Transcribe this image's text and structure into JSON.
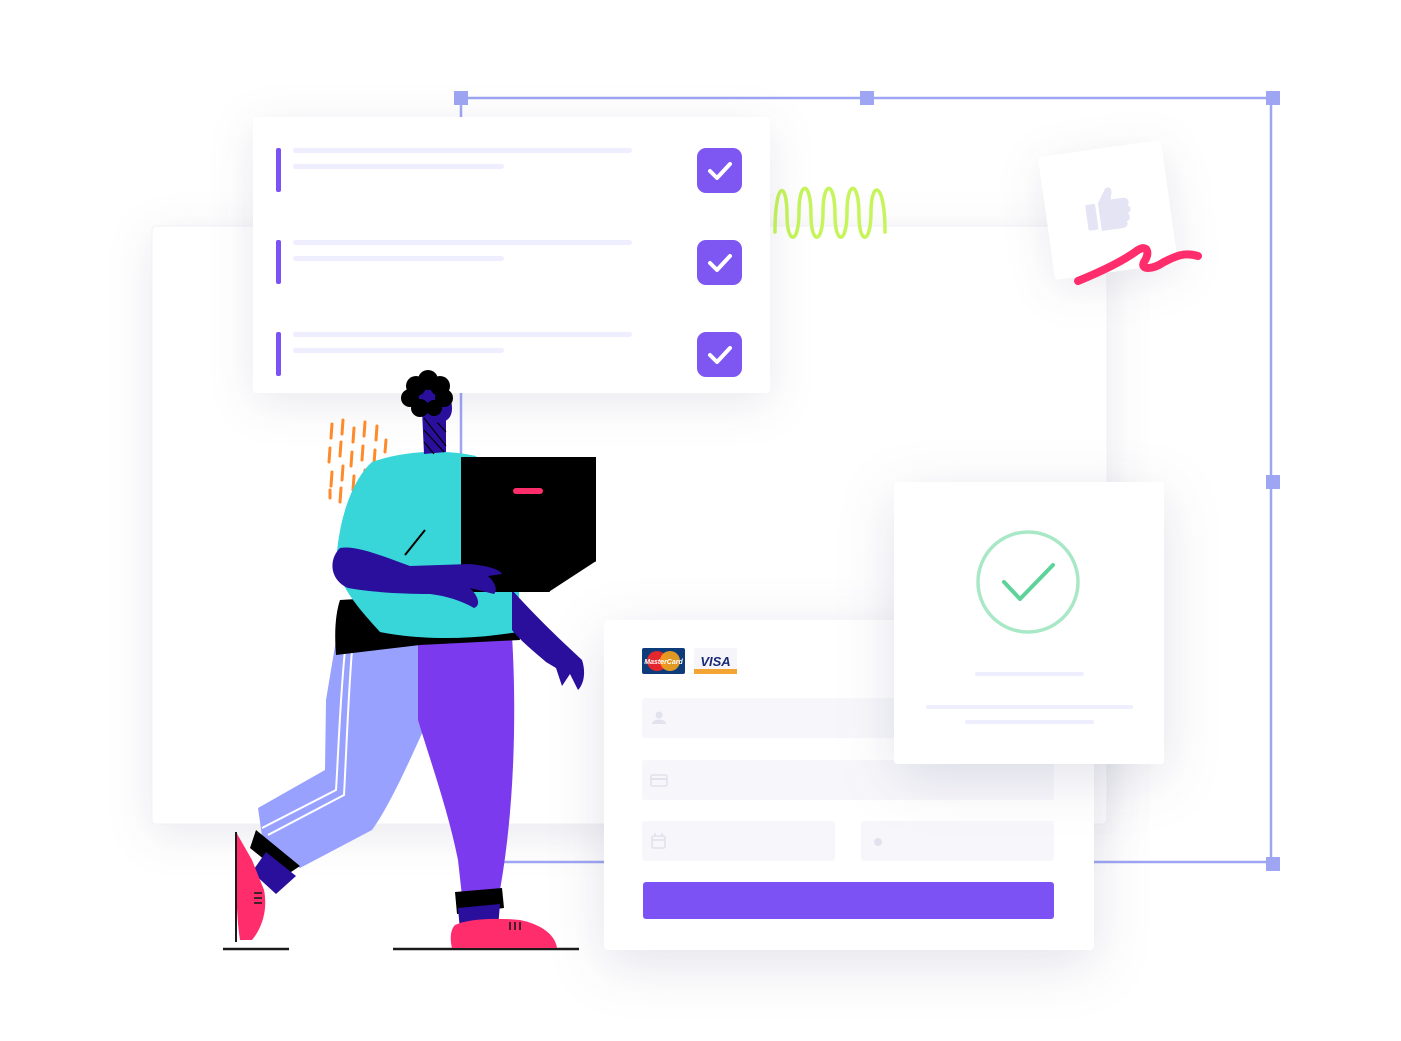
{
  "colors": {
    "accent": "#7C52F4",
    "checkbox": "#7E56F2",
    "frame": "#9EA6F3",
    "placeholder_line": "#EFEEFE",
    "success_ring": "#A9E8C6",
    "success_check": "#5DD39A",
    "pink": "#FF2D6C",
    "squiggle": "#C5F55A",
    "teal_shirt": "#38D6D9",
    "skin": "#2A0E9C",
    "trousers_light": "#99A1FF",
    "trousers_dark": "#7B3AEE",
    "box": "#000000",
    "dashes": "#FF8A2A"
  },
  "checklist": {
    "items": [
      {
        "checked": true
      },
      {
        "checked": true
      },
      {
        "checked": true
      }
    ]
  },
  "payment": {
    "card_logos": {
      "mastercard": "MasterCard",
      "visa": "VISA"
    },
    "fields": {
      "name_icon": "user-icon",
      "card_icon": "credit-card-icon",
      "date_icon": "calendar-icon",
      "cvv_icon": "lock-icon"
    }
  },
  "icons": {
    "thumbs_up": "thumbs-up-icon",
    "success": "check-circle-icon",
    "checkbox": "checkmark-icon"
  }
}
